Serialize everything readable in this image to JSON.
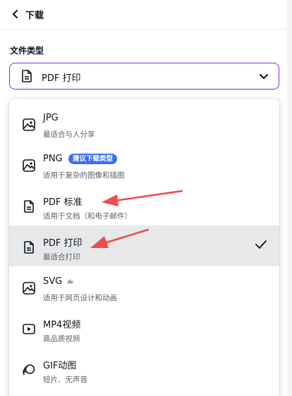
{
  "header": {
    "title": "下载",
    "back_icon": "chevron-left-icon"
  },
  "file_type": {
    "label": "文件类型",
    "selected_value": "PDF 打印",
    "selected_icon": "document-icon",
    "accent_color": "#7d2ae8"
  },
  "options": [
    {
      "title": "JPG",
      "desc": "最适合与人分享",
      "icon": "image-icon",
      "selected": false
    },
    {
      "title": "PNG",
      "desc": "适用于复杂的图像和插图",
      "icon": "image-icon",
      "badge": "建议下载类型",
      "selected": false
    },
    {
      "title": "PDF 标准",
      "desc": "适用于文档（和电子邮件）",
      "icon": "document-icon",
      "selected": false
    },
    {
      "title": "PDF 打印",
      "desc": "最适合打印",
      "icon": "document-icon",
      "selected": true
    },
    {
      "title": "SVG",
      "desc": "适用于网页设计和动画",
      "icon": "image-icon",
      "premium_icon": "crown-icon",
      "selected": false
    },
    {
      "title": "MP4视频",
      "desc": "高品质视频",
      "icon": "video-icon",
      "selected": false
    },
    {
      "title": "GIF动图",
      "desc": "短片、无声音",
      "icon": "gif-icon",
      "selected": false
    }
  ],
  "colors": {
    "badge": "#3b6cf6",
    "selected_row": "#e7e8ea",
    "annotation_arrow": "#ef4b4b"
  }
}
